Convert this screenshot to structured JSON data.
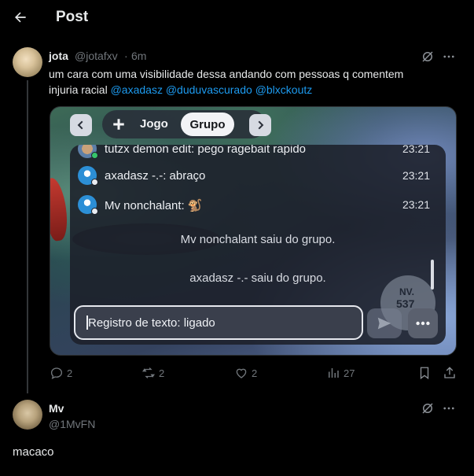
{
  "header": {
    "title": "Post"
  },
  "tweet": {
    "author_name": "jota",
    "author_handle": "@jotafxv",
    "separator": "·",
    "time": "6m",
    "text_line1": "um cara com uma visibilidade dessa andando com pessoas q comentem",
    "text_line2": "injuria racial",
    "mentions": [
      "@axadasz",
      "@duduvascurado",
      "@blxckoutz"
    ],
    "stats": {
      "replies": "2",
      "reposts": "2",
      "likes": "2",
      "views": "27"
    }
  },
  "media": {
    "tabs": {
      "jogo": "Jogo",
      "grupo": "Grupo"
    },
    "chat": [
      {
        "user": "tutzx demon edit",
        "text": "tutzx demon edit: pego ragebait rapido",
        "time": "23:21"
      },
      {
        "user": "axadasz -.-",
        "text": "axadasz -.-: abraço",
        "time": "23:21"
      },
      {
        "user": "Mv nonchalant",
        "text": "Mv nonchalant: 🐒",
        "time": "23:21"
      }
    ],
    "system_messages": [
      "Mv nonchalant saiu do grupo.",
      "axadasz -.- saiu do grupo."
    ],
    "input_text": "Registro de texto: ligado",
    "nv_label": "NV.",
    "nv_value": "537"
  },
  "reply": {
    "author_name": "Mv",
    "author_handle": "@1MvFN",
    "text": "macaco"
  },
  "icons": {
    "back": "arrow-left-icon",
    "grok": "grok-icon",
    "more": "more-horizontal-icon",
    "reply": "reply-icon",
    "repost": "repost-icon",
    "like": "heart-icon",
    "views": "views-icon",
    "bookmark": "bookmark-icon",
    "share": "share-icon"
  },
  "colors": {
    "accent": "#1d9bf0",
    "muted": "#71767b",
    "background": "#000000"
  }
}
